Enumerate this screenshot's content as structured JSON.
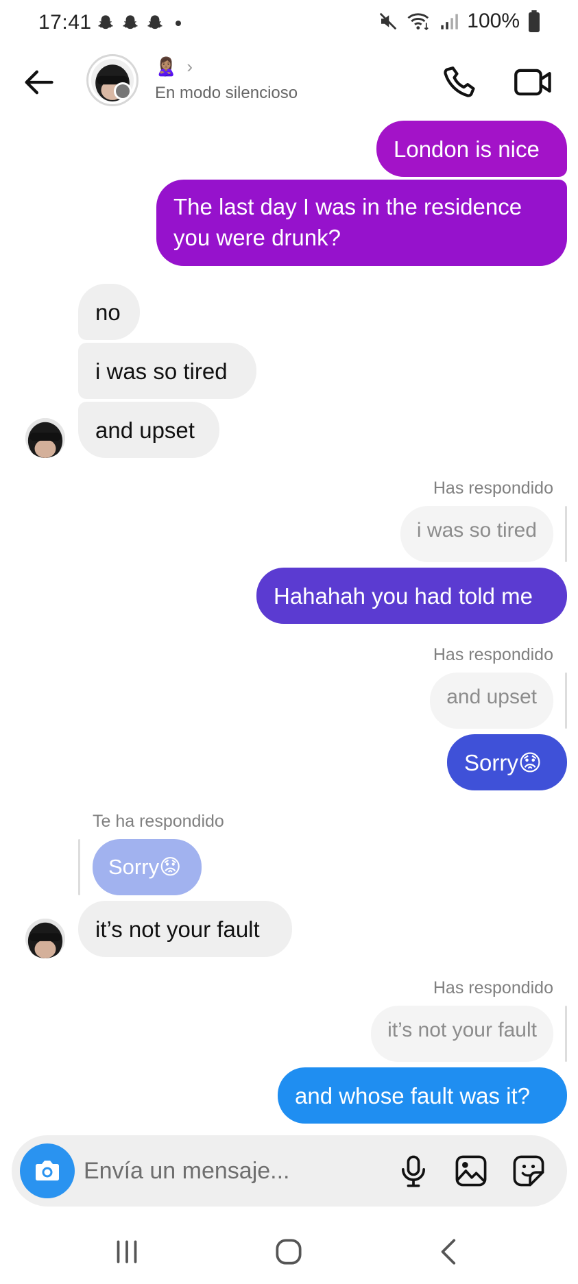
{
  "status_bar": {
    "time": "17:41",
    "battery": "100%",
    "notification_icons": [
      "snapchat-icon",
      "snapchat-icon",
      "snapchat-icon"
    ]
  },
  "header": {
    "name_emoji": "🙎🏽‍♀️",
    "chevron": "›",
    "subtitle": "En modo silencioso"
  },
  "messages": {
    "m1": "London is nice",
    "m2_line1": "The last day I was in the residence",
    "m2_line2": "you were drunk?",
    "m3": "no",
    "m4": "i was so tired",
    "m5": "and upset",
    "reply_label_1": "Has respondido",
    "reply_quote_1": "i was so tired",
    "m6": "Hahahah you had told me",
    "reply_label_2": "Has respondido",
    "reply_quote_2": "and upset",
    "m7": "Sorry😟",
    "reply_label_3": "Te ha respondido",
    "reply_quote_3": "Sorry😟",
    "m8": "it’s not your fault",
    "reply_label_4": "Has respondido",
    "reply_quote_4": "it’s not your fault",
    "m9": "and whose fault was it?"
  },
  "composer": {
    "placeholder": "Envía un mensaje..."
  },
  "colors": {
    "gradient_top": "#a413c8",
    "gradient_mid": "#5f3dd3",
    "gradient_bottom": "#1f8ef1",
    "incoming_bg": "#efefef",
    "camera_blue": "#2a93f0"
  }
}
